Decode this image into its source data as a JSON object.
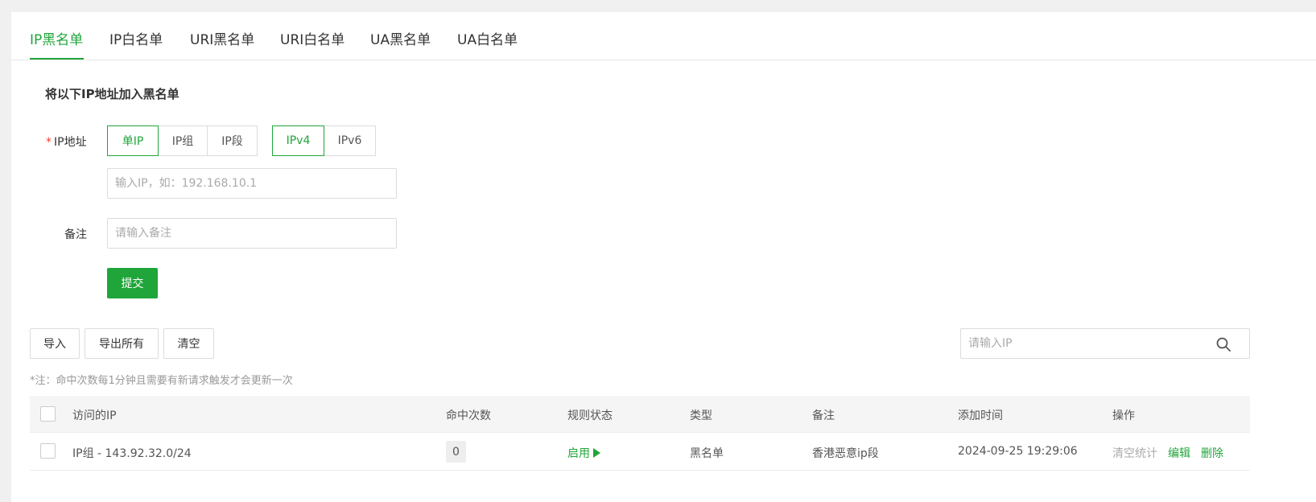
{
  "tabs": [
    {
      "label": "IP黑名单",
      "active": true
    },
    {
      "label": "IP白名单",
      "active": false
    },
    {
      "label": "URI黑名单",
      "active": false
    },
    {
      "label": "URI白名单",
      "active": false
    },
    {
      "label": "UA黑名单",
      "active": false
    },
    {
      "label": "UA白名单",
      "active": false
    }
  ],
  "form": {
    "title": "将以下IP地址加入黑名单",
    "ip_label": "IP地址",
    "required_mark": "*",
    "ip_modes": [
      {
        "label": "单IP",
        "selected": true
      },
      {
        "label": "IP组",
        "selected": false
      },
      {
        "label": "IP段",
        "selected": false
      }
    ],
    "ip_versions": [
      {
        "label": "IPv4",
        "selected": true
      },
      {
        "label": "IPv6",
        "selected": false
      }
    ],
    "ip_placeholder": "输入IP，如：192.168.10.1",
    "ip_value": "",
    "remark_label": "备注",
    "remark_placeholder": "请输入备注",
    "remark_value": "",
    "submit_label": "提交"
  },
  "toolbar": {
    "import_label": "导入",
    "export_label": "导出所有",
    "clear_label": "清空",
    "search_placeholder": "请输入IP",
    "search_value": "",
    "search_icon": "search-icon"
  },
  "note": "*注：命中次数每1分钟且需要有新请求触发才会更新一次",
  "table": {
    "headers": [
      "访问的IP",
      "命中次数",
      "规则状态",
      "类型",
      "备注",
      "添加时间",
      "操作"
    ],
    "rows": [
      {
        "ip": "IP组 - 143.92.32.0/24",
        "hits": "0",
        "status": "启用",
        "type": "黑名单",
        "remark": "香港恶意ip段",
        "added": "2024-09-25 19:29:06",
        "actions": {
          "clear": "清空统计",
          "edit": "编辑",
          "delete": "删除"
        }
      }
    ]
  },
  "colors": {
    "accent": "#20a53a",
    "required": "#f0412b",
    "muted": "#999999"
  }
}
